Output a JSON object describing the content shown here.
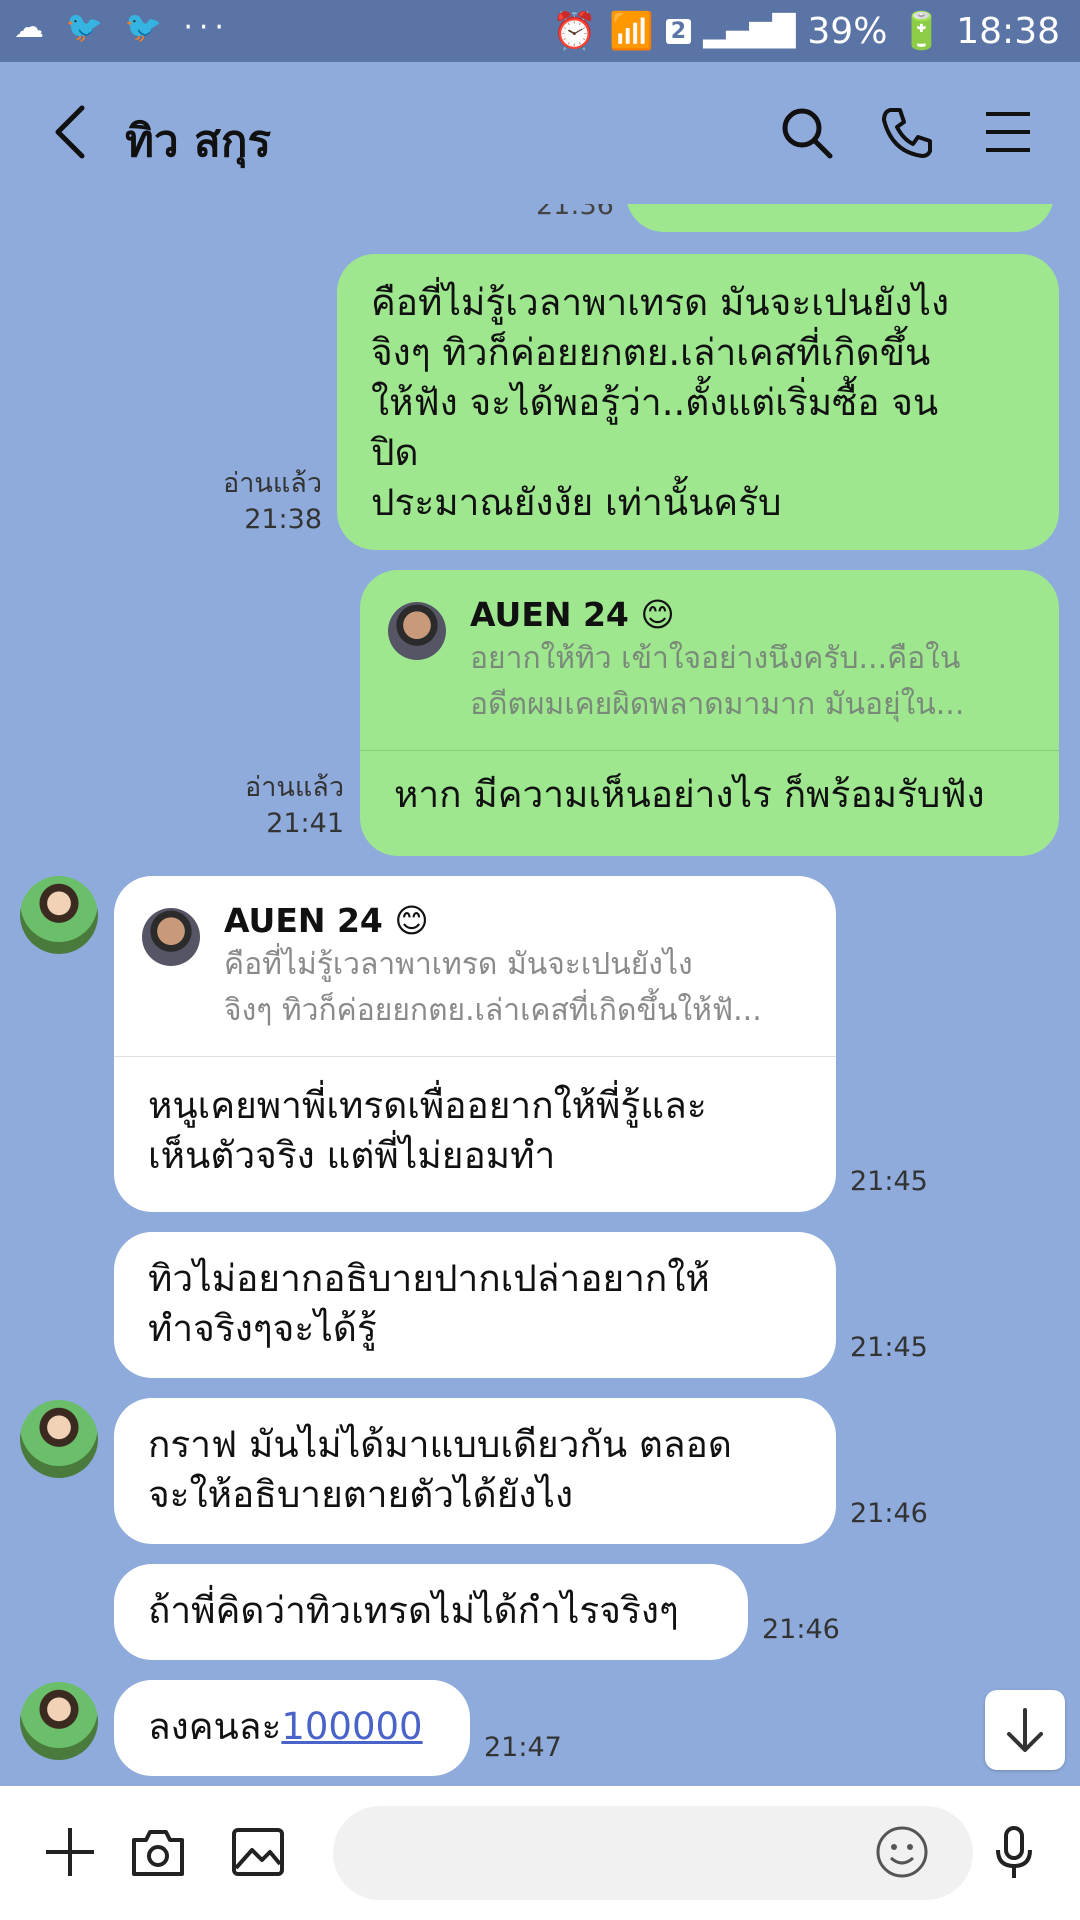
{
  "status_bar": {
    "notification_icons": [
      "cloud-icon",
      "bird-icon",
      "bird-icon",
      "more-icon"
    ],
    "sim_slot": "2",
    "battery": "39%",
    "time": "18:38"
  },
  "header": {
    "contact_name": "ทิว สกุร",
    "icons": [
      "back-icon",
      "search-icon",
      "call-icon",
      "menu-icon"
    ]
  },
  "messages": {
    "partial_top_time": "21:36",
    "m1": {
      "lines": [
        "คือที่ไม่รู้เวลาพาเทรด  มันจะเปนยังไง",
        "จิงๆ ทิวก็ค่อยยกตย.เล่าเคสที่เกิดขึ้น",
        "ให้ฟัง  จะได้พอรู้ว่า..ตั้งแต่เริ่มซื้อ จน",
        "ปิด",
        "ประมาณยังงัย เท่านั้นครับ"
      ],
      "read": "อ่านแล้ว",
      "time": "21:38"
    },
    "m2": {
      "quote_name": "AUEN 24 😊",
      "quote_lines": [
        "อยากให้ทิว เข้าใจอย่างนึงครับ...คือใน",
        "อดีตผมเคยผิดพลาดมามาก  มันอยุ่ใน..."
      ],
      "text": "หาก มีความเห็นอย่างไร ก็พร้อมรับฟัง",
      "read": "อ่านแล้ว",
      "time": "21:41"
    },
    "m3": {
      "quote_name": "AUEN 24 😊",
      "quote_lines": [
        "คือที่ไม่รู้เวลาพาเทรด  มันจะเปนยังไง",
        "จิงๆ ทิวก็ค่อยยกตย.เล่าเคสที่เกิดขึ้นให้ฟั..."
      ],
      "lines": [
        "หนูเคยพาพี่เทรดเพื่ออยากให้พี่รู้และ",
        "เห็นตัวจริง แต่พี่ไม่ยอมทำ"
      ],
      "time": "21:45"
    },
    "m4": {
      "lines": [
        "ทิวไม่อยากอธิบายปากเปล่าอยากให้",
        "ทำจริงๆจะได้รู้"
      ],
      "time": "21:45"
    },
    "m5": {
      "lines": [
        "กราฟ มันไม่ได้มาแบบเดียวกัน ตลอด",
        "จะให้อธิบายตายตัวได้ยังไง"
      ],
      "time": "21:46"
    },
    "m6": {
      "text": "ถ้าพี่คิดว่าทิวเทรดไม่ได้กำไรจริงๆ",
      "time": "21:46"
    },
    "m7": {
      "text_prefix": "ลงคนละ",
      "link": "100000",
      "time": "21:47"
    }
  },
  "input_bar": {
    "icons": [
      "plus-icon",
      "camera-icon",
      "image-icon",
      "emoji-icon",
      "mic-icon"
    ]
  },
  "colors": {
    "background": "#8fabdc",
    "outgoing_bubble": "#9ee78f",
    "incoming_bubble": "#ffffff",
    "status_bar": "#5b74a6",
    "link": "#4a63c9"
  }
}
